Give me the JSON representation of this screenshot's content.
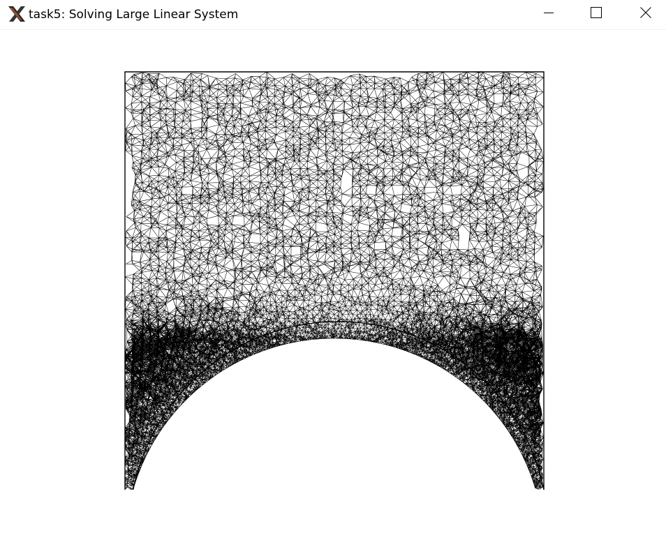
{
  "window": {
    "title": "task5: Solving Large Linear System",
    "icon": "x11-logo-icon",
    "controls": {
      "minimize": "minimize-icon",
      "maximize": "maximize-icon",
      "close": "close-icon"
    }
  },
  "mesh": {
    "colors": {
      "edge": "#000000",
      "background": "#ffffff"
    }
  }
}
